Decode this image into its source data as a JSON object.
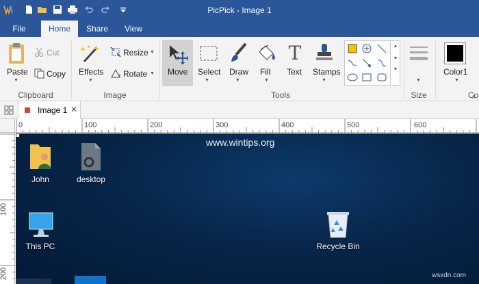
{
  "window": {
    "title": "PicPick - Image 1"
  },
  "tabs": {
    "file": "File",
    "home": "Home",
    "share": "Share",
    "view": "View"
  },
  "ribbon": {
    "paste": "Paste",
    "cut": "Cut",
    "copy": "Copy",
    "effects": "Effects",
    "resize": "Resize",
    "rotate": "Rotate",
    "move": "Move",
    "select": "Select",
    "draw": "Draw",
    "fill": "Fill",
    "text": "Text",
    "stamps": "Stamps",
    "color1": "Color1",
    "groups": {
      "clipboard": "Clipboard",
      "image": "Image",
      "tools": "Tools",
      "size": "Size",
      "colors_partial": "Co"
    },
    "text_icon_glyph": "T"
  },
  "document": {
    "tab": "Image 1"
  },
  "ruler": {
    "h_ticks": [
      "0",
      "100",
      "200",
      "300",
      "400",
      "500",
      "600"
    ],
    "v_ticks": [
      "100",
      "200"
    ]
  },
  "desktop": {
    "watermark": "www.wintips.org",
    "icons": {
      "john": "John",
      "desktop": "desktop",
      "thispc": "This PC",
      "recycle": "Recycle Bin"
    }
  },
  "footer_watermark": "wsxdn.com",
  "colors": {
    "titlebar": "#2b579a",
    "ribbon_bg": "#f3f3f3",
    "accent_yellow": "#f5c400",
    "doc_icon": "#d04a2a"
  }
}
